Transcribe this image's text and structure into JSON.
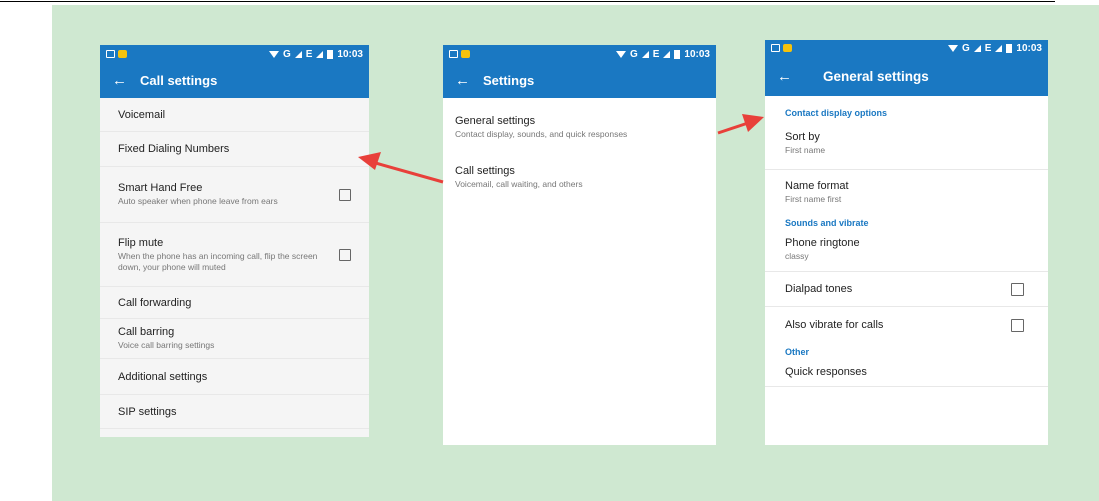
{
  "status": {
    "network": "G",
    "network2": "E",
    "time": "10:03"
  },
  "screen_call": {
    "title": "Call settings",
    "items": [
      {
        "title": "Voicemail"
      },
      {
        "title": "Fixed Dialing Numbers"
      },
      {
        "title": "Smart Hand Free",
        "sub": "Auto speaker when phone leave from ears"
      },
      {
        "title": "Flip mute",
        "sub": "When the phone has an incoming call, flip the screen down, your phone will muted"
      },
      {
        "title": "Call forwarding"
      },
      {
        "title": "Call barring",
        "sub": "Voice call barring settings"
      },
      {
        "title": "Additional settings"
      },
      {
        "title": "SIP settings"
      }
    ]
  },
  "screen_settings": {
    "title": "Settings",
    "items": [
      {
        "title": "General settings",
        "sub": "Contact display, sounds, and quick responses"
      },
      {
        "title": "Call settings",
        "sub": "Voicemail, call waiting, and others"
      }
    ]
  },
  "screen_general": {
    "title": "General settings",
    "sections": [
      {
        "label": "Contact display options"
      },
      {
        "label": "Sounds and vibrate"
      },
      {
        "label": "Other"
      }
    ],
    "items": [
      {
        "title": "Sort by",
        "sub": "First name"
      },
      {
        "title": "Name format",
        "sub": "First name first"
      },
      {
        "title": "Phone ringtone",
        "sub": "classy"
      },
      {
        "title": "Dialpad tones"
      },
      {
        "title": "Also vibrate for calls"
      },
      {
        "title": "Quick responses"
      }
    ]
  },
  "colors": {
    "accent": "#1a78c2",
    "background": "#cfe8d1",
    "arrow": "#e8403a"
  }
}
